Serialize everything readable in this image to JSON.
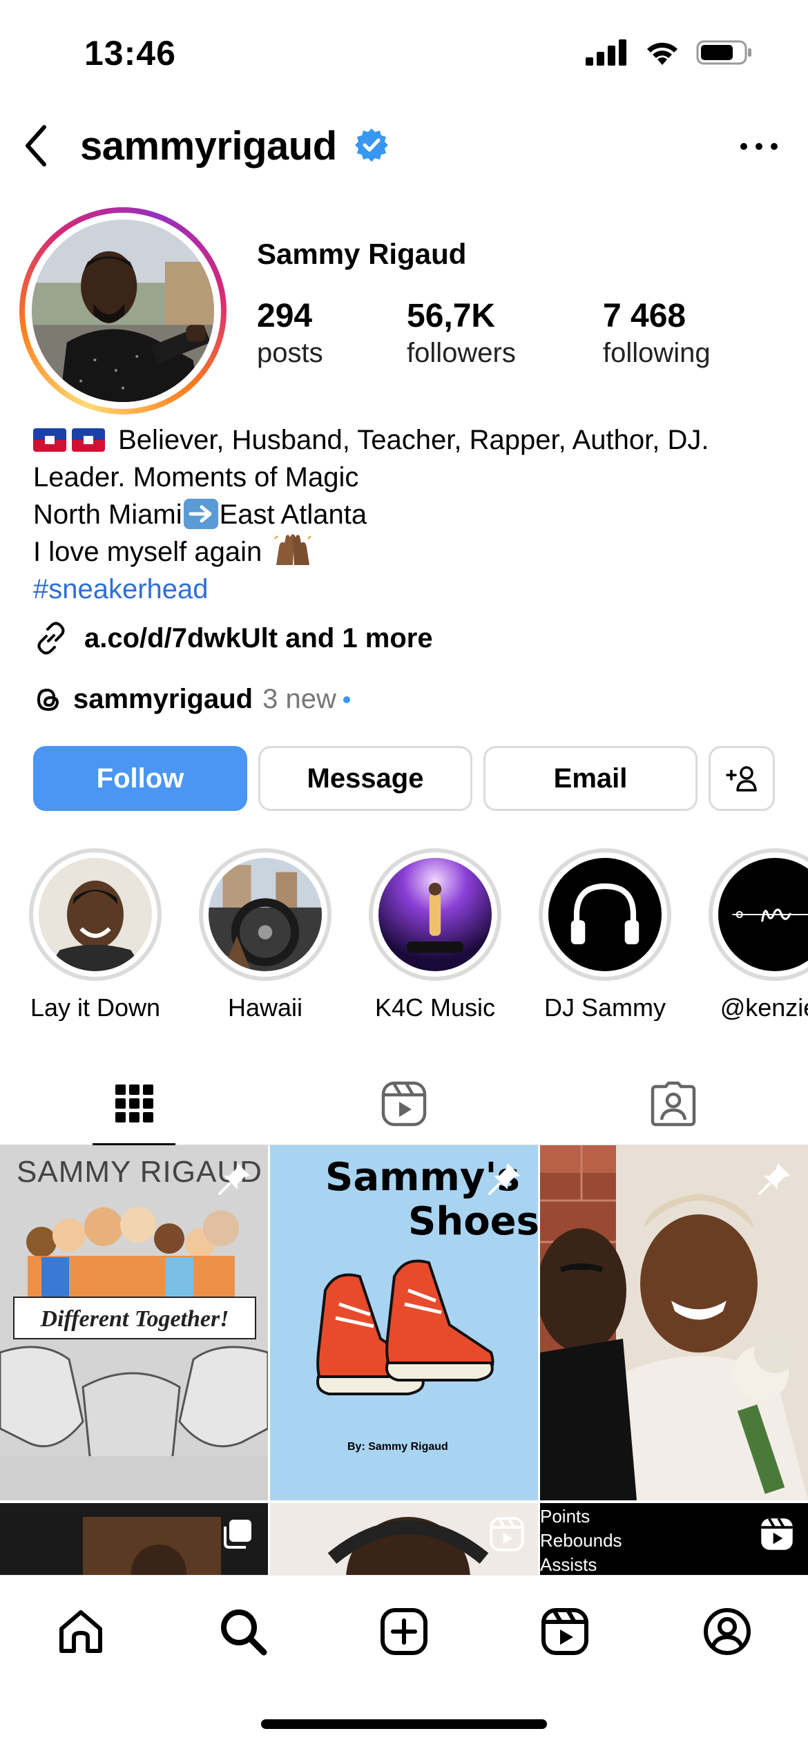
{
  "status_bar": {
    "time": "13:46"
  },
  "header": {
    "username": "sammyrigaud"
  },
  "profile": {
    "display_name": "Sammy Rigaud",
    "stats": [
      {
        "value": "294",
        "label": "posts"
      },
      {
        "value": "56,7K",
        "label": "followers"
      },
      {
        "value": "7 468",
        "label": "following"
      }
    ]
  },
  "bio": {
    "line1": "Believer, Husband, Teacher, Rapper, Author, DJ.",
    "line2": "Leader. Moments of Magic",
    "line3a": "North Miami",
    "line3b": "East Atlanta",
    "line4": "I love myself again",
    "hashtag": "#sneakerhead"
  },
  "link": {
    "text": "a.co/d/7dwkUlt and 1 more"
  },
  "threads": {
    "name": "sammyrigaud",
    "new": "3 new"
  },
  "actions": {
    "follow": "Follow",
    "message": "Message",
    "email": "Email"
  },
  "highlights": [
    {
      "label": "Lay it Down"
    },
    {
      "label": "Hawaii"
    },
    {
      "label": "K4C Music"
    },
    {
      "label": "DJ Sammy"
    },
    {
      "label": "@kenzies"
    }
  ],
  "tabs": [
    "grid-icon",
    "reels-icon",
    "tagged-icon"
  ],
  "posts": {
    "post1": {
      "title": "SAMMY RIGAUD",
      "banner": "Different Together!"
    },
    "post2": {
      "title1": "Sammy's",
      "title2": "Shoes",
      "byline": "By: Sammy Rigaud"
    },
    "row2_text": [
      "Points",
      "Rebounds",
      "Assists"
    ]
  },
  "colors": {
    "accent": "#4a96f2",
    "verified": "#3897f0",
    "hashtag": "#2f6fd6"
  }
}
